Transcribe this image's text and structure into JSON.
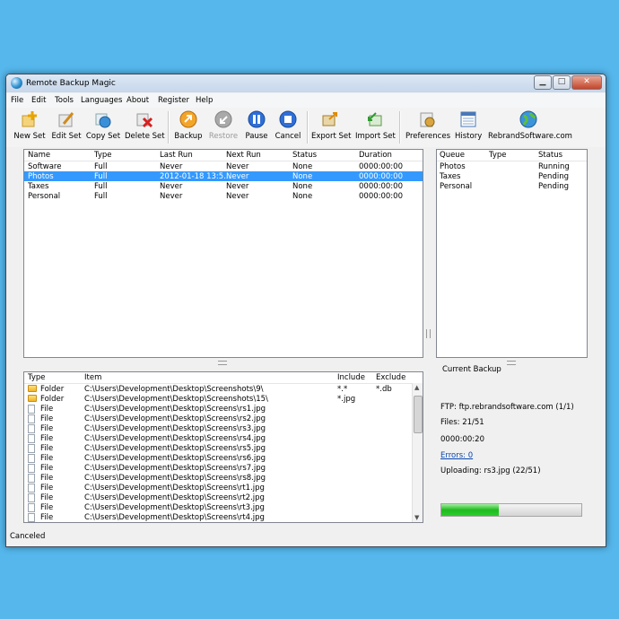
{
  "window": {
    "title": "Remote Backup Magic"
  },
  "menu": [
    "File",
    "Edit",
    "Tools",
    "Languages",
    "About",
    "Register",
    "Help"
  ],
  "toolbar": {
    "new_set": "New Set",
    "edit_set": "Edit Set",
    "copy_set": "Copy Set",
    "delete_set": "Delete Set",
    "backup": "Backup",
    "restore": "Restore",
    "pause": "Pause",
    "cancel": "Cancel",
    "export_set": "Export Set",
    "import_set": "Import Set",
    "preferences": "Preferences",
    "history": "History",
    "rebrand": "RebrandSoftware.com"
  },
  "sets": {
    "columns": [
      "Name",
      "Type",
      "Last Run",
      "Next Run",
      "Status",
      "Duration"
    ],
    "rows": [
      [
        "Software",
        "Full",
        "Never",
        "Never",
        "None",
        "0000:00:00"
      ],
      [
        "Photos",
        "Full",
        "2012-01-18 13:5...",
        "Never",
        "None",
        "0000:00:00"
      ],
      [
        "Taxes",
        "Full",
        "Never",
        "Never",
        "None",
        "0000:00:00"
      ],
      [
        "Personal",
        "Full",
        "Never",
        "Never",
        "None",
        "0000:00:00"
      ]
    ],
    "selected_index": 1
  },
  "queue": {
    "columns": [
      "Queue",
      "Type",
      "Status"
    ],
    "rows": [
      [
        "Photos",
        "",
        "Running"
      ],
      [
        "Taxes",
        "",
        "Pending"
      ],
      [
        "Personal",
        "",
        "Pending"
      ]
    ]
  },
  "items": {
    "columns": [
      "Type",
      "Item",
      "Include",
      "Exclude"
    ],
    "rows": [
      [
        "Folder",
        "C:\\Users\\Development\\Desktop\\Screenshots\\9\\",
        "*.*",
        "*.db"
      ],
      [
        "Folder",
        "C:\\Users\\Development\\Desktop\\Screenshots\\15\\",
        "*.jpg",
        ""
      ],
      [
        "File",
        "C:\\Users\\Development\\Desktop\\Screens\\rs1.jpg",
        "",
        ""
      ],
      [
        "File",
        "C:\\Users\\Development\\Desktop\\Screens\\rs2.jpg",
        "",
        ""
      ],
      [
        "File",
        "C:\\Users\\Development\\Desktop\\Screens\\rs3.jpg",
        "",
        ""
      ],
      [
        "File",
        "C:\\Users\\Development\\Desktop\\Screens\\rs4.jpg",
        "",
        ""
      ],
      [
        "File",
        "C:\\Users\\Development\\Desktop\\Screens\\rs5.jpg",
        "",
        ""
      ],
      [
        "File",
        "C:\\Users\\Development\\Desktop\\Screens\\rs6.jpg",
        "",
        ""
      ],
      [
        "File",
        "C:\\Users\\Development\\Desktop\\Screens\\rs7.jpg",
        "",
        ""
      ],
      [
        "File",
        "C:\\Users\\Development\\Desktop\\Screens\\rs8.jpg",
        "",
        ""
      ],
      [
        "File",
        "C:\\Users\\Development\\Desktop\\Screens\\rt1.jpg",
        "",
        ""
      ],
      [
        "File",
        "C:\\Users\\Development\\Desktop\\Screens\\rt2.jpg",
        "",
        ""
      ],
      [
        "File",
        "C:\\Users\\Development\\Desktop\\Screens\\rt3.jpg",
        "",
        ""
      ],
      [
        "File",
        "C:\\Users\\Development\\Desktop\\Screens\\rt4.jpg",
        "",
        ""
      ]
    ]
  },
  "current_backup": {
    "title": "Current Backup",
    "ftp": "FTP: ftp.rebrandsoftware.com (1/1)",
    "files": "Files: 21/51",
    "elapsed": "0000:00:20",
    "errors": "Errors: 0",
    "uploading": "Uploading: rs3.jpg (22/51)",
    "progress_fraction": 0.41
  },
  "statusbar": {
    "text": "Canceled"
  },
  "colors": {
    "desktop": "#55b7ec",
    "selection": "#3399ff",
    "progress": "#1fba1f"
  }
}
